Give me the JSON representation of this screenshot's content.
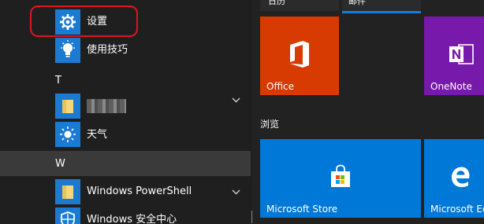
{
  "app_list": {
    "settings_label": "设置",
    "tips_label": "使用技巧",
    "section_t": "T",
    "blurred_app_label": "",
    "weather_label": "天气",
    "section_w": "W",
    "powershell_label": "Windows PowerShell",
    "security_label": "Windows 安全中心"
  },
  "tiles": {
    "top_cut_left": "日历",
    "top_cut_right": "邮件",
    "office_label": "Office",
    "onenote_label": "OneNote",
    "browse_group": "浏览",
    "store_label": "Microsoft Store",
    "edge_label": "Microsoft Edge"
  },
  "colors": {
    "accent": "#1b7bd3",
    "office": "#d83b01",
    "onenote": "#7719aa",
    "annotation": "#e0141e"
  },
  "icons": {
    "settings": "gear-icon",
    "tips": "lightbulb-icon",
    "weather": "sun-icon",
    "powershell": "folder-icon",
    "security": "shield-icon",
    "store": "shopping-bag-icon",
    "edge": "edge-icon"
  }
}
